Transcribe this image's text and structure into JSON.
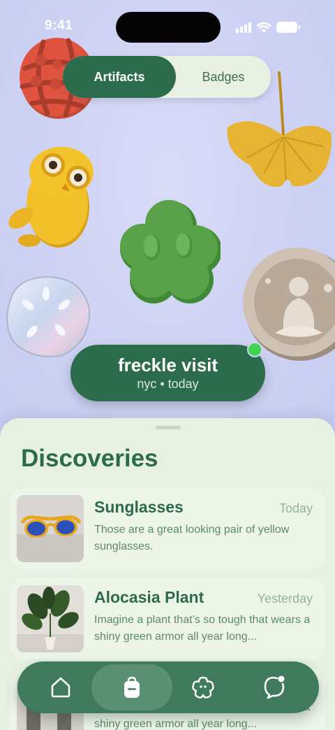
{
  "status_bar": {
    "time": "9:41"
  },
  "segmented_control": {
    "active": "Artifacts",
    "inactive": "Badges"
  },
  "artifacts": [
    {
      "icon": "globe-clay-icon",
      "color": "#e0543f"
    },
    {
      "icon": "ginkgo-leaf-icon",
      "color": "#e0b030"
    },
    {
      "icon": "owl-clay-icon",
      "color": "#f2c12a"
    },
    {
      "icon": "flower-clay-icon",
      "color": "#5aa24a"
    },
    {
      "icon": "sand-dollar-icon",
      "color": "#d6d9ea"
    },
    {
      "icon": "buddha-coin-icon",
      "color": "#c9b9a8"
    }
  ],
  "visit": {
    "title": "freckle visit",
    "subtitle": "nyc • today",
    "live_color": "#3fd44f"
  },
  "sheet": {
    "title": "Discoveries"
  },
  "discoveries": [
    {
      "title": "Sunglasses",
      "date": "Today",
      "description": "Those are a great looking pair of yellow sunglasses."
    },
    {
      "title": "Alocasia Plant",
      "date": "Yesterday",
      "description": "Imagine a plant that’s so tough that wears a shiny green armor all year long..."
    },
    {
      "title": "",
      "date": "",
      "description": "Imagine a plant that’s so tough that wears a shiny green armor all year long..."
    }
  ],
  "tab_bar": {
    "tabs": [
      {
        "icon": "home-icon",
        "active": false
      },
      {
        "icon": "backpack-icon",
        "active": true
      },
      {
        "icon": "flower-icon",
        "active": false
      },
      {
        "icon": "chat-icon",
        "active": false
      }
    ]
  },
  "colors": {
    "brand_green": "#2d6b4d",
    "sheet_bg": "#e6f1e1",
    "hero_bg": "#cfd3f4"
  }
}
